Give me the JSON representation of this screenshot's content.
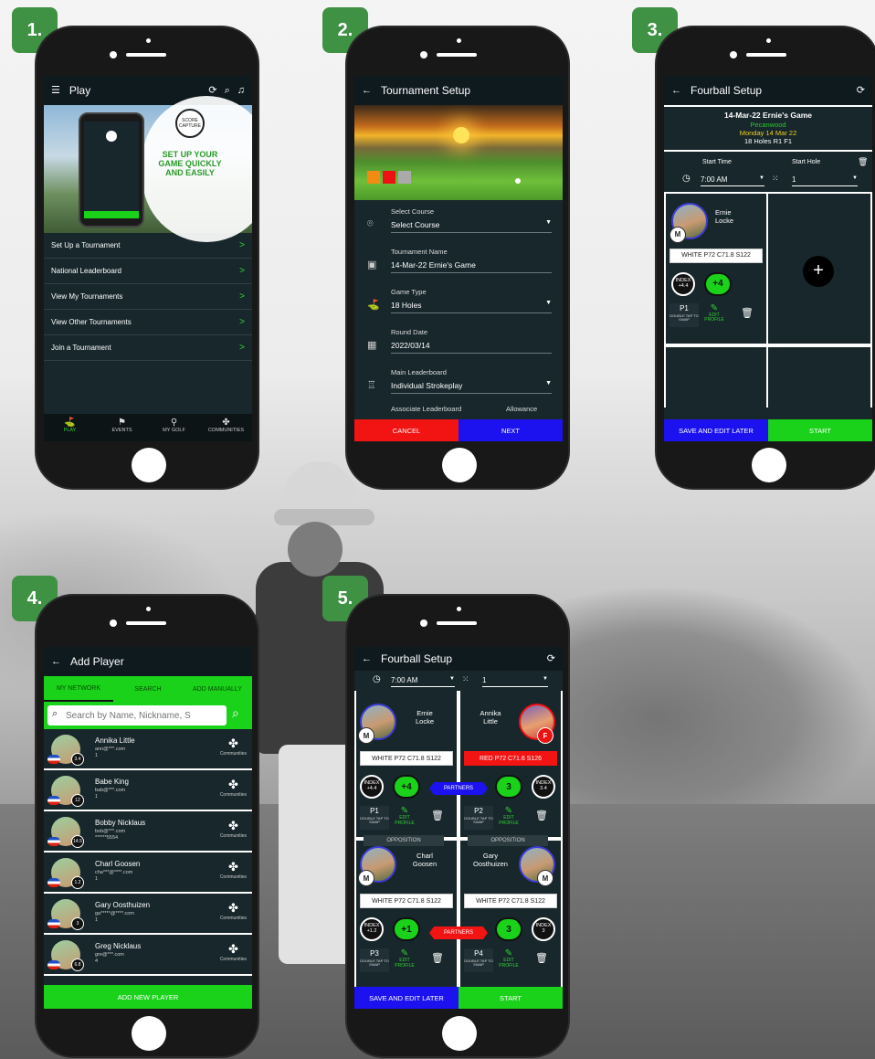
{
  "steps": [
    "1.",
    "2.",
    "3.",
    "4.",
    "5."
  ],
  "p1": {
    "title": "Play",
    "promo": "SET UP YOUR GAME QUICKLY AND EASILY",
    "logo": "SCORE CAPTURE",
    "menu": [
      "Set Up a Tournament",
      "National Leaderboard",
      "View My Tournaments",
      "View Other Tournaments",
      "Join a Tournament"
    ],
    "nav": [
      "PLAY",
      "EVENTS",
      "MY GOLF",
      "COMMUNITIES"
    ]
  },
  "p2": {
    "title": "Tournament Setup",
    "fields": [
      {
        "label": "Select Course",
        "value": "Select Course",
        "icon": "pin-icon"
      },
      {
        "label": "Tournament Name",
        "value": "14-Mar-22 Ernie's Game",
        "icon": "id-icon"
      },
      {
        "label": "Game Type",
        "value": "18 Holes",
        "icon": "flag-icon"
      },
      {
        "label": "Round Date",
        "value": "2022/03/14",
        "icon": "calendar-icon"
      },
      {
        "label": "Main Leaderboard",
        "value": "Individual Strokeplay",
        "icon": "leaderboard-icon"
      }
    ],
    "assoc": "Associate Leaderboard",
    "allowance": "Allowance",
    "cancel": "CANCEL",
    "next": "NEXT"
  },
  "p3": {
    "title": "Fourball Setup",
    "game": "14-Mar-22 Ernie's Game",
    "course": "Pecanwood",
    "date": "Monday 14 Mar 22",
    "holes": "18 Holes R1 F1",
    "start_time_label": "Start Time",
    "start_hole_label": "Start Hole",
    "start_time": "7:00 AM",
    "start_hole": "1",
    "player": {
      "name1": "Ernie",
      "name2": "Locke",
      "tag": "M",
      "tee": "WHITE  P72  C71.8  S122",
      "index": "INDEX\n+4.4",
      "hcp": "+4",
      "pos": "P1",
      "swap": "DOUBLE TAP TO SWAP",
      "edit": "EDIT PROFILE"
    },
    "save": "SAVE AND EDIT LATER",
    "start": "START"
  },
  "p4": {
    "title": "Add Player",
    "tabs": [
      "MY NETWORK",
      "SEARCH",
      "ADD MANUALLY"
    ],
    "search_placeholder": "Search by Name, Nickname, S",
    "players": [
      {
        "name": "Annika Little",
        "email": "ann@***.com",
        "extra": "1",
        "num": "3.4"
      },
      {
        "name": "Babe King",
        "email": "bab@***.com",
        "extra": "1",
        "num": "12"
      },
      {
        "name": "Bobby Nicklaus",
        "email": "bob@***.com",
        "extra": "******5554",
        "num": "14.5"
      },
      {
        "name": "Charl Goosen",
        "email": "cha***@****.com",
        "extra": "1",
        "num": "1.2"
      },
      {
        "name": "Gary Oosthuizen",
        "email": "ga*****@****.com",
        "extra": "1",
        "num": "3"
      },
      {
        "name": "Greg Nicklaus",
        "email": "gre@***.com",
        "extra": "4",
        "num": "6.8"
      }
    ],
    "communities": "Communities",
    "add": "ADD NEW PLAYER"
  },
  "p5": {
    "title": "Fourball Setup",
    "start_time": "7:00 AM",
    "start_hole": "1",
    "players": [
      {
        "first": "Ernie",
        "last": "Locke",
        "tag": "M",
        "tee": "WHITE  P72  C71.8  S122",
        "index": "INDEX\n+4.4",
        "hcp": "+4",
        "pos": "P1"
      },
      {
        "first": "Annika",
        "last": "Little",
        "tag": "F",
        "tee": "RED     P72  C71.6  S126",
        "index": "INDEX\n3.4",
        "hcp": "3",
        "pos": "P2"
      },
      {
        "first": "Charl",
        "last": "Goosen",
        "tag": "M",
        "tee": "WHITE  P72  C71.8  S122",
        "index": "INDEX\n+1.2",
        "hcp": "+1",
        "pos": "P3"
      },
      {
        "first": "Gary",
        "last": "Oosthuizen",
        "tag": "M",
        "tee": "WHITE  P72  C71.8  S122",
        "index": "INDEX\n3",
        "hcp": "3",
        "pos": "P4"
      }
    ],
    "partners": "PARTNERS",
    "opposition": "OPPOSITION",
    "swap": "DOUBLE TAP TO SWAP",
    "edit": "EDIT PROFILE",
    "save": "SAVE AND EDIT LATER",
    "start": "START"
  }
}
